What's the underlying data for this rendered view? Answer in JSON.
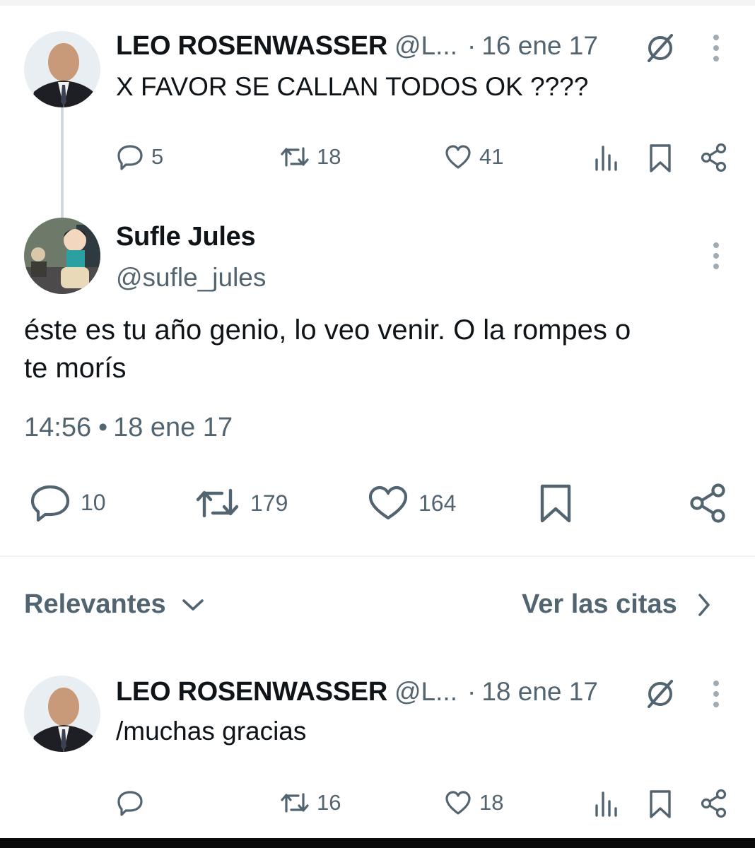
{
  "tweet_parent": {
    "author_name": "LEO ROSENWASSER",
    "handle": "@L...",
    "date": "16 ene 17",
    "text": "X FAVOR SE CALLAN TODOS OK ????",
    "replies": "5",
    "retweets": "18",
    "likes": "41"
  },
  "tweet_main": {
    "author_name": "Sufle Jules",
    "handle": "@sufle_jules",
    "text_line1": "éste es tu año genio, lo veo venir. O la rompes o",
    "text_line2": "te morís",
    "time": "14:56",
    "date": "18 ene 17",
    "replies": "10",
    "retweets": "179",
    "likes": "164"
  },
  "sort_bar": {
    "relevant_label": "Relevantes",
    "quotes_label": "Ver las citas"
  },
  "tweet_reply": {
    "author_name": "LEO ROSENWASSER",
    "handle": "@L...",
    "date": "18 ene 17",
    "text": "/muchas gracias",
    "replies": "",
    "retweets": "16",
    "likes": "18"
  },
  "colors": {
    "text_primary": "#0f1419",
    "text_secondary": "#536471",
    "divider": "#eff3f4",
    "thread_line": "#cfd9de"
  },
  "icons": [
    "reply-icon",
    "retweet-icon",
    "like-icon",
    "views-icon",
    "bookmark-icon",
    "share-icon",
    "grok-icon",
    "more-icon",
    "chevron-down-icon",
    "chevron-right-icon"
  ]
}
